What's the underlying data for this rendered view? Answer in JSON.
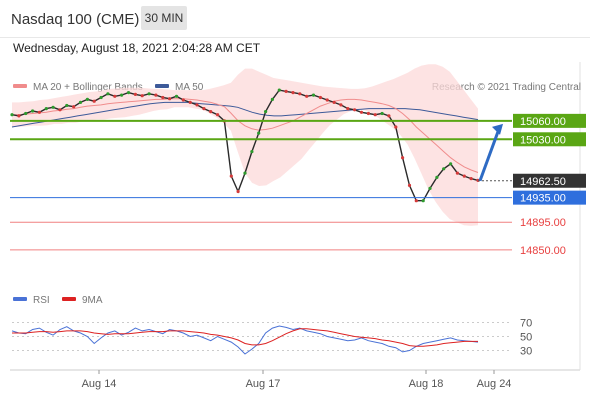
{
  "header": {
    "title": "Nasdaq 100 (CME)",
    "timeframe": "30 MIN",
    "datetime": "Wednesday, August 18, 2021 2:04:28 AM CET"
  },
  "legend": {
    "bollinger_label": "MA 20 + Bollinger Bands",
    "bollinger_color": "#f08c8c",
    "ma50_label": "MA 50",
    "ma50_color": "#3d5a99",
    "credit": "Research © 2021 Trading Central",
    "rsi_label": "RSI",
    "rsi_color": "#4a72d6",
    "ma9_label": "9MA",
    "ma9_color": "#dd2222"
  },
  "chart_data": {
    "type": "line",
    "price_axis": {
      "range": [
        14840,
        15120
      ]
    },
    "x_ticks": [
      "Aug 14",
      "Aug 17",
      "Aug 18",
      "Aug 24"
    ],
    "levels": [
      {
        "label": "15060.00",
        "value": 15060,
        "color": "#5aa614",
        "kind": "resistance"
      },
      {
        "label": "15030.00",
        "value": 15030,
        "color": "#5aa614",
        "kind": "resistance"
      },
      {
        "label": "14962.50",
        "value": 14962.5,
        "color": "#333333",
        "kind": "last-price"
      },
      {
        "label": "14935.00",
        "value": 14935,
        "color": "#2f6fdd",
        "kind": "pivot"
      },
      {
        "label": "14895.00",
        "value": 14895,
        "color": "#e84040",
        "kind": "support"
      },
      {
        "label": "14850.00",
        "value": 14850,
        "color": "#e84040",
        "kind": "support"
      }
    ],
    "price": [
      15070,
      15068,
      15072,
      15076,
      15074,
      15080,
      15082,
      15078,
      15085,
      15083,
      15090,
      15095,
      15092,
      15098,
      15104,
      15100,
      15102,
      15106,
      15103,
      15101,
      15104,
      15102,
      15098,
      15096,
      15100,
      15094,
      15090,
      15086,
      15080,
      15075,
      15070,
      15060,
      14970,
      14945,
      14975,
      15010,
      15040,
      15075,
      15095,
      15110,
      15108,
      15106,
      15104,
      15100,
      15102,
      15098,
      15094,
      15090,
      15086,
      15080,
      15078,
      15074,
      15072,
      15070,
      15072,
      15068,
      15050,
      15000,
      14955,
      14930,
      14930,
      14950,
      14968,
      14982,
      14990,
      14975,
      14970,
      14966,
      14963
    ],
    "ma20": [
      15070,
      15070,
      15071,
      15072,
      15073,
      15074,
      15076,
      15077,
      15079,
      15080,
      15082,
      15084,
      15085,
      15086,
      15088,
      15089,
      15090,
      15091,
      15092,
      15093,
      15094,
      15095,
      15095,
      15096,
      15096,
      15096,
      15095,
      15094,
      15092,
      15090,
      15087,
      15083,
      15072,
      15060,
      15052,
      15047,
      15045,
      15046,
      15048,
      15052,
      15056,
      15060,
      15066,
      15072,
      15078,
      15084,
      15088,
      15092,
      15094,
      15095,
      15095,
      15094,
      15092,
      15090,
      15088,
      15085,
      15080,
      15072,
      15062,
      15050,
      15040,
      15030,
      15020,
      15010,
      15000,
      14992,
      14985,
      14980,
      14976
    ],
    "bb_upper": [
      15090,
      15090,
      15091,
      15092,
      15094,
      15095,
      15097,
      15099,
      15101,
      15103,
      15105,
      15107,
      15108,
      15110,
      15112,
      15113,
      15114,
      15114,
      15114,
      15113,
      15112,
      15112,
      15111,
      15110,
      15110,
      15110,
      15110,
      15110,
      15112,
      15115,
      15118,
      15122,
      15135,
      15145,
      15145,
      15140,
      15135,
      15130,
      15128,
      15126,
      15124,
      15122,
      15120,
      15118,
      15116,
      15115,
      15114,
      15113,
      15112,
      15112,
      15113,
      15116,
      15120,
      15124,
      15128,
      15133,
      15138,
      15145,
      15150,
      15152,
      15152,
      15148,
      15140,
      15125,
      15110,
      15095,
      15080
    ],
    "bb_lower": [
      15050,
      15050,
      15051,
      15052,
      15052,
      15053,
      15055,
      15055,
      15057,
      15057,
      15059,
      15061,
      15062,
      15062,
      15064,
      15065,
      15066,
      15068,
      15070,
      15073,
      15076,
      15078,
      15079,
      15082,
      15082,
      15082,
      15080,
      15078,
      15072,
      15065,
      15056,
      15044,
      15009,
      14975,
      14959,
      14954,
      14955,
      14962,
      14968,
      14978,
      14988,
      14998,
      15012,
      15026,
      15040,
      15053,
      15062,
      15071,
      15076,
      15078,
      15077,
      15072,
      15064,
      15056,
      15048,
      15037,
      15022,
      14999,
      14974,
      14948,
      14928,
      14912,
      14900,
      14895,
      14890,
      14889,
      14890
    ],
    "ma50": [
      15050,
      15052,
      15054,
      15056,
      15058,
      15060,
      15062,
      15064,
      15066,
      15068,
      15070,
      15072,
      15074,
      15076,
      15078,
      15080,
      15082,
      15084,
      15086,
      15088,
      15089,
      15090,
      15090,
      15090,
      15090,
      15089,
      15088,
      15087,
      15086,
      15085,
      15084,
      15082,
      15078,
      15074,
      15071,
      15069,
      15068,
      15068,
      15069,
      15070,
      15071,
      15072,
      15073,
      15074,
      15075,
      15076,
      15077,
      15078,
      15079,
      15080,
      15080,
      15080,
      15080,
      15080,
      15080,
      15079,
      15078,
      15076,
      15074,
      15072,
      15070,
      15068,
      15066,
      15064,
      15062
    ],
    "projection": {
      "from": 14962.5,
      "to": 15055
    },
    "rsi_axis": {
      "range": [
        5,
        85
      ],
      "ticks": [
        70,
        50,
        30
      ]
    },
    "rsi": [
      58,
      55,
      54,
      60,
      62,
      56,
      52,
      60,
      64,
      58,
      55,
      50,
      40,
      48,
      55,
      58,
      52,
      56,
      62,
      58,
      60,
      57,
      54,
      60,
      58,
      55,
      50,
      52,
      48,
      44,
      50,
      46,
      42,
      35,
      25,
      32,
      40,
      55,
      62,
      65,
      63,
      60,
      62,
      58,
      56,
      54,
      50,
      48,
      46,
      44,
      45,
      48,
      44,
      42,
      40,
      36,
      34,
      28,
      30,
      36,
      40,
      42,
      44,
      46,
      48,
      45,
      44,
      43,
      42
    ],
    "rsi_ma9": [
      55,
      55,
      55,
      56,
      57,
      57,
      56,
      57,
      58,
      58,
      58,
      57,
      55,
      54,
      53,
      54,
      54,
      54,
      55,
      56,
      57,
      57,
      57,
      58,
      58,
      58,
      57,
      56,
      55,
      53,
      52,
      50,
      48,
      45,
      40,
      38,
      38,
      40,
      44,
      49,
      54,
      58,
      61,
      61,
      60,
      59,
      58,
      56,
      54,
      52,
      50,
      49,
      48,
      47,
      45,
      44,
      42,
      40,
      37,
      36,
      36,
      37,
      38,
      40,
      41,
      42,
      43,
      43,
      43
    ]
  }
}
